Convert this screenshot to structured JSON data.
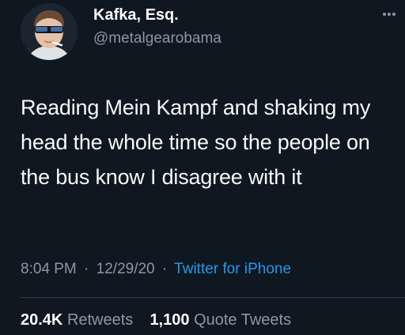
{
  "user": {
    "display_name": "Kafka, Esq.",
    "handle": "@metalgearobama"
  },
  "icons": {
    "avatar": "profile-photo",
    "more": "more-options-icon"
  },
  "tweet": {
    "text": "Reading Mein Kampf and shaking my head the whole time so the people on the bus know I disagree with it",
    "time": "8:04 PM",
    "date": "12/29/20",
    "separator": "·",
    "source": "Twitter for iPhone"
  },
  "stats": {
    "retweets_count": "20.4K",
    "retweets_label": "Retweets",
    "quotes_count": "1,100",
    "quotes_label": "Quote Tweets"
  },
  "colors": {
    "background": "#0f1720",
    "text": "#f7f9f9",
    "secondary": "#8b98a5",
    "link": "#1d9bf0"
  }
}
